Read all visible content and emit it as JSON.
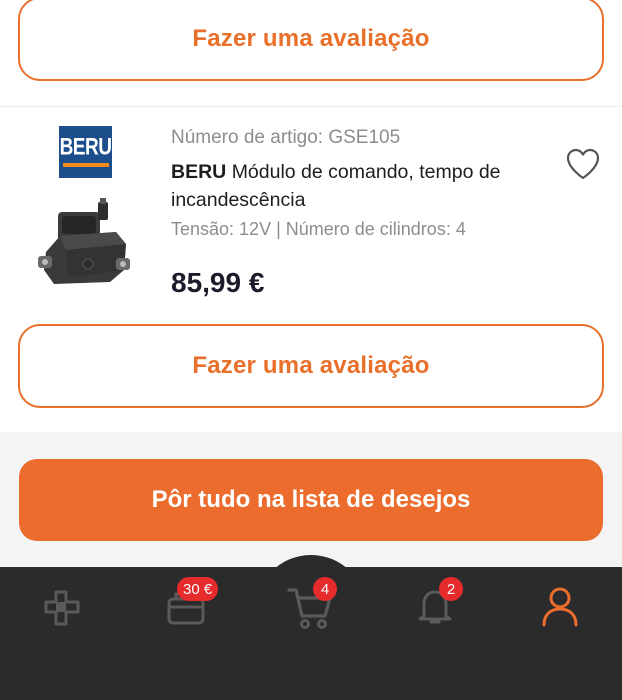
{
  "review_top": {
    "label": "Fazer uma avaliação"
  },
  "product": {
    "brand_logo_text": "BERU",
    "article_number": "Número de artigo: GSE105",
    "brand": "BERU",
    "name": "Módulo de comando, tempo de incandescência",
    "specs": "Tensão: 12V | Número de cilindros: 4",
    "price": "85,99 €",
    "wishlist_icon": "heart-icon"
  },
  "review_bottom": {
    "label": "Fazer uma avaliação"
  },
  "wishlist_all": {
    "label": "Pôr tudo na lista de desejos"
  },
  "bottom_nav": {
    "items": [
      {
        "name": "home",
        "icon": "plus-logo-icon"
      },
      {
        "name": "wallet",
        "icon": "wallet-icon",
        "badge": "30 €"
      },
      {
        "name": "cart",
        "icon": "cart-icon",
        "badge": "4"
      },
      {
        "name": "notifications",
        "icon": "bell-icon",
        "badge": "2"
      },
      {
        "name": "account",
        "icon": "user-icon"
      }
    ]
  },
  "colors": {
    "accent": "#ec6c2d",
    "badge": "#e52b2b",
    "nav_bg": "#2b2b2b",
    "active_icon": "#ec6c2d"
  }
}
